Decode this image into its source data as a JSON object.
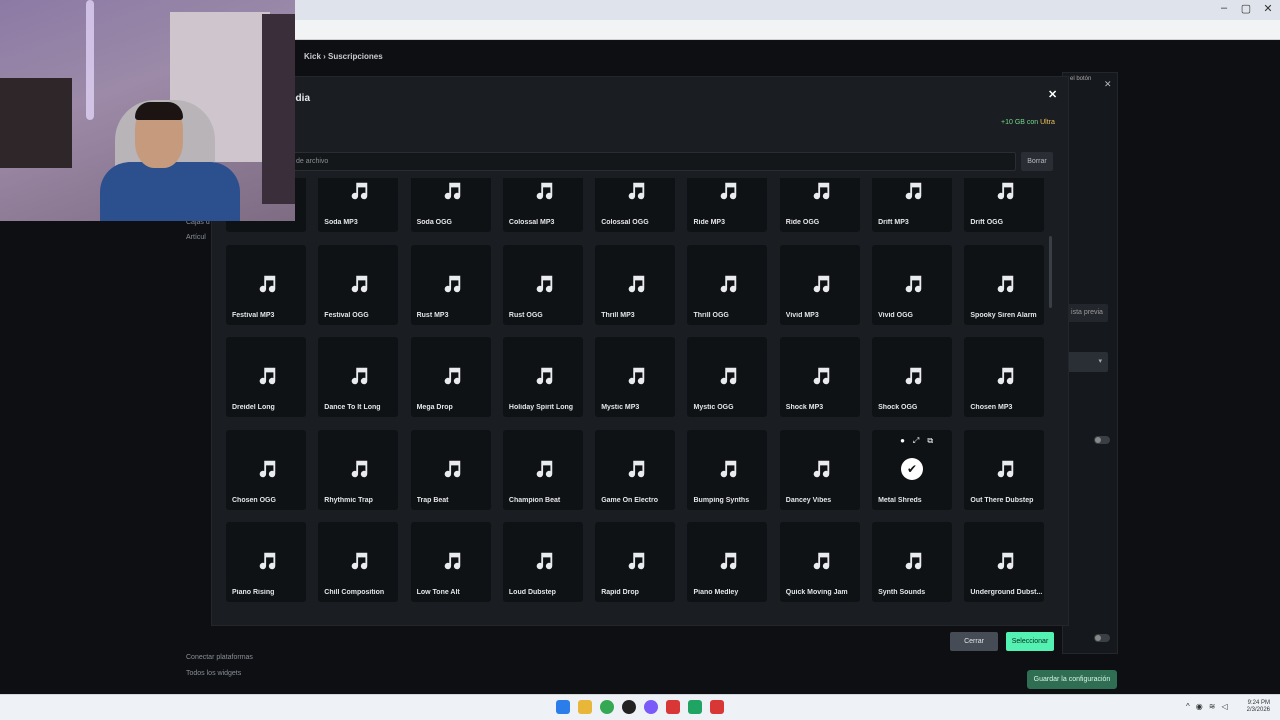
{
  "browser": {
    "window_controls": [
      "–",
      "▢",
      "✕"
    ]
  },
  "page": {
    "breadcrumb": "Kick › Suscripciones",
    "side_links": [
      "Conectar plataformas",
      "Todos los widgets"
    ],
    "side_partial": [
      "Cajas d",
      "Artícul"
    ],
    "right_panel_note": "el botón",
    "right_panel_preview": "ista previa",
    "save_button": "Guardar la configuración"
  },
  "modal": {
    "title": "edia",
    "ultra_note_prefix": "+10 GB con ",
    "ultra_note_highlight": "Ultra",
    "search_placeholder": "de archivo",
    "clear_button": "Borrar",
    "cancel_button": "Cerrar",
    "select_button": "Seleccionar",
    "tiles": [
      "",
      "Soda MP3",
      "Soda OGG",
      "Colossal MP3",
      "Colossal OGG",
      "Ride MP3",
      "Ride OGG",
      "Drift MP3",
      "Drift OGG",
      "Festival MP3",
      "Festival OGG",
      "Rust MP3",
      "Rust OGG",
      "Thrill MP3",
      "Thrill OGG",
      "Vivid MP3",
      "Vivid OGG",
      "Spooky Siren Alarm",
      "Dreidel Long",
      "Dance To It Long",
      "Mega Drop",
      "Holiday Spirit Long",
      "Mystic MP3",
      "Mystic OGG",
      "Shock MP3",
      "Shock OGG",
      "Chosen MP3",
      "Chosen OGG",
      "Rhythmic Trap",
      "Trap Beat",
      "Champion Beat",
      "Game On Electro",
      "Bumping Synths",
      "Dancey Vibes",
      "Metal Shreds",
      "Out There Dubstep",
      "Piano Rising",
      "Chill Composition",
      "Low Tone Alt",
      "Loud Dubstep",
      "Rapid Drop",
      "Piano Medley",
      "Quick Moving Jam",
      "Synth Sounds",
      "Underground Dubst...",
      "",
      "",
      "",
      "",
      "",
      "",
      "",
      "",
      ""
    ],
    "selected_tile": "Metal Shreds"
  },
  "taskbar": {
    "time": "9:24 PM",
    "date": "2/3/2026"
  },
  "colors": {
    "accent": "#53f2b2",
    "ultra": "#e8c15a",
    "modal_bg": "#1a1d21",
    "tile_bg": "#0f1215"
  }
}
